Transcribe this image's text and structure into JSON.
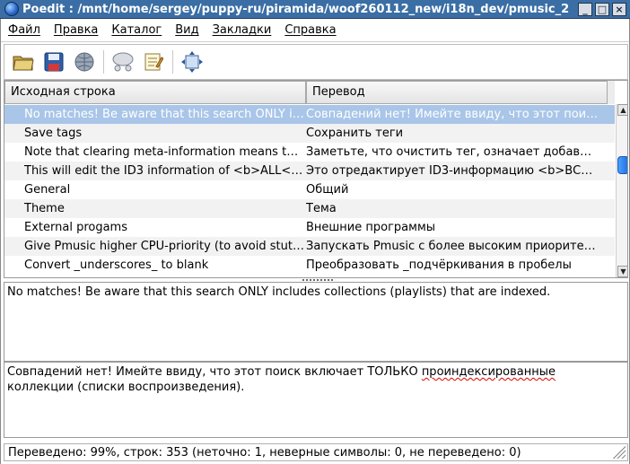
{
  "window": {
    "title": "Poedit : /mnt/home/sergey/puppy-ru/piramida/woof260112_new/i18n_dev/pmusic_2",
    "controls": [
      "minimize-icon",
      "maximize-icon",
      "close-icon"
    ]
  },
  "menu": {
    "items": [
      "Файл",
      "Правка",
      "Каталог",
      "Вид",
      "Закладки",
      "Справка"
    ]
  },
  "toolbar": {
    "buttons": [
      "open-folder-icon",
      "save-icon",
      "globe-icon",
      "validate-icon",
      "comment-icon",
      "fit-window-icon"
    ]
  },
  "list": {
    "columns": {
      "source": "Исходная строка",
      "translation": "Перевод"
    },
    "rows": [
      {
        "source": "No matches! Be aware that this search ONLY i…",
        "translation": "Совпадений нет! Имейте ввиду, что этот пои…",
        "selected": true
      },
      {
        "source": "Save tags",
        "translation": "Сохранить теги"
      },
      {
        "source": "Note that clearing meta-information means t…",
        "translation": "Заметьте, что очистить тег, означает добав…"
      },
      {
        "source": "This will edit the ID3 information of <b>ALL</…",
        "translation": "Это отредактирует ID3-информацию <b>ВС…"
      },
      {
        "source": "General",
        "translation": "Общий"
      },
      {
        "source": "Theme",
        "translation": "Тема"
      },
      {
        "source": "External progams",
        "translation": "Внешние программы"
      },
      {
        "source": "Give Pmusic higher CPU-priority (to avoid stut…",
        "translation": "Запускать Pmusic с более высоким приорите…"
      },
      {
        "source": "Convert _underscores_ to blank",
        "translation": "Преобразовать _подчёркивания в пробелы"
      }
    ]
  },
  "source_pane": {
    "text": "No matches! Be aware that this search ONLY includes collections (playlists) that are indexed."
  },
  "translation_pane": {
    "text_before": "Совпадений нет! Имейте ввиду, что этот поиск включает ТОЛЬКО ",
    "misspelled": "проиндексированные",
    "text_after": " коллекции (списки воспроизведения)."
  },
  "status": {
    "text": "Переведено: 99%, строк: 353 (неточно: 1, неверные символы: 0, не переведено: 0)"
  },
  "colors": {
    "titlebar": "#3a6ea5",
    "selected_row": "#a9c5e8",
    "scroll_thumb": "#1f6fe0"
  }
}
